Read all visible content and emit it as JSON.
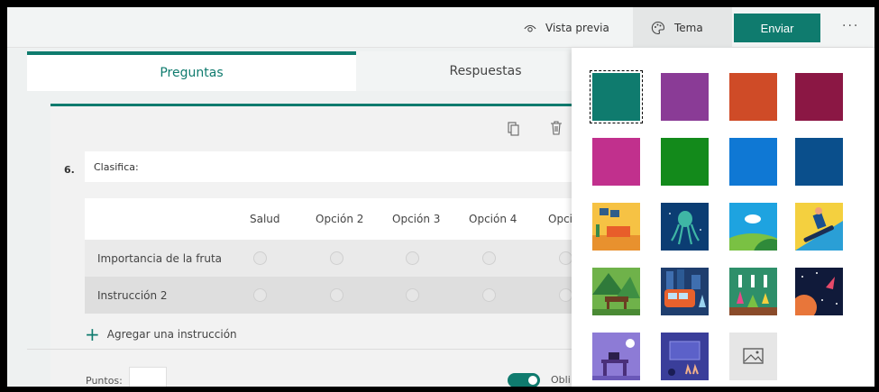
{
  "topbar": {
    "preview_label": "Vista previa",
    "theme_label": "Tema",
    "send_label": "Enviar",
    "more_label": "···"
  },
  "tabs": {
    "questions": "Preguntas",
    "responses": "Respuestas"
  },
  "question": {
    "number": "6.",
    "title": "Clasifica:",
    "columns": [
      "Salud",
      "Opción 2",
      "Opción 3",
      "Opción 4",
      "Opci"
    ],
    "rows": [
      "Importancia de la fruta",
      "Instrucción 2"
    ],
    "add_instruction": "Agregar una instrucción",
    "points_label": "Puntos:",
    "required_label": "Obli"
  },
  "theme_panel": {
    "solid_colors": [
      "#0f7b6e",
      "#8a3b96",
      "#cf4b27",
      "#8b1744",
      "#c1308d",
      "#138a1b",
      "#0f78d4",
      "#0a4f8c"
    ],
    "image_themes": [
      "living-room-theme",
      "octopus-theme",
      "sky-hills-theme",
      "snowboard-theme",
      "forest-bench-theme",
      "city-bus-theme",
      "lab-flasks-theme",
      "space-rocket-theme",
      "purple-desk-theme",
      "laptop-theme",
      "custom-image-theme"
    ],
    "selected": "#0f7b6e"
  }
}
